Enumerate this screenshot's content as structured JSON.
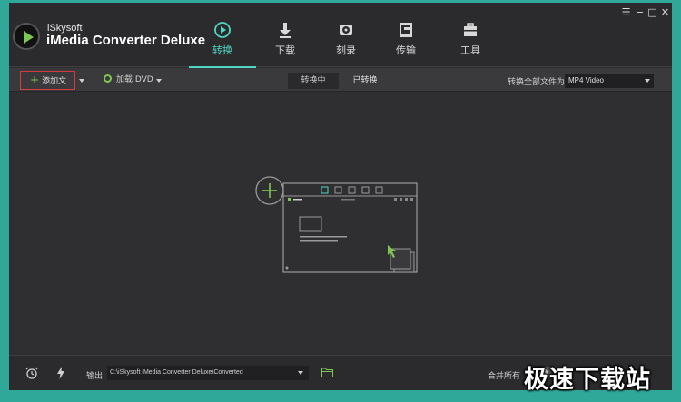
{
  "app": {
    "brand_small": "iSkysoft",
    "brand_big": "iMedia Converter Deluxe"
  },
  "window_controls": {
    "menu": "☰",
    "minimize": "−",
    "maximize": "□",
    "close": "✕"
  },
  "tabs": [
    {
      "label": "转换",
      "icon": "convert-icon",
      "active": true
    },
    {
      "label": "下载",
      "icon": "download-icon",
      "active": false
    },
    {
      "label": "刻录",
      "icon": "burn-icon",
      "active": false
    },
    {
      "label": "传输",
      "icon": "transfer-icon",
      "active": false
    },
    {
      "label": "工具",
      "icon": "toolbox-icon",
      "active": false
    }
  ],
  "toolbar": {
    "add_files": "添加文件",
    "load_dvd": "加载 DVD",
    "segment_converting": "转换中",
    "segment_converted": "已转换",
    "convert_all_label": "转换全部文件为:",
    "format_value": "MP4 Video"
  },
  "bottombar": {
    "output_label": "输出",
    "output_path": "C:\\iSkysoft iMedia Converter Deluxe\\Converted",
    "merge_label": "合并所有"
  },
  "watermark": "极速下载站",
  "colors": {
    "accent": "#4fd6c2",
    "green": "#7ec850",
    "highlight_border": "#d23c3c",
    "frame": "#2fa89a"
  }
}
